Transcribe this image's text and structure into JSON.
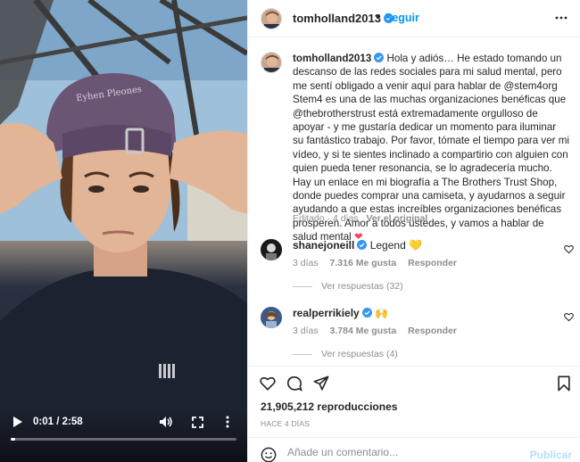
{
  "video": {
    "time": "0:01 / 2:58",
    "progress": 0.006,
    "cap_text": "Eyhen Pleones",
    "icons": {
      "play": "play-icon",
      "volume": "volume-icon",
      "fullscreen": "fullscreen-icon",
      "more": "more-vertical-icon"
    }
  },
  "header": {
    "username": "tomholland2013",
    "separator": "•",
    "follow_label": "Seguir",
    "more_icon": "more-horizontal-icon"
  },
  "caption": {
    "username": "tomholland2013",
    "text": "Hola y adiós… He estado tomando un descanso de las redes sociales para mi salud mental, pero me sentí obligado a venir aquí para hablar de @stem4org Stem4 es una de las muchas organizaciones benéficas que @thebrotherstrust está extremadamente orgulloso de apoyar - y me gustaría dedicar un momento para iluminar su fantástico trabajo. Por favor, tómate el tiempo para ver mi vídeo, y si te sientes inclinado a compartirio con alguien con quien pueda tener resonancia, se lo agradecería mucho. Hay un enlace en mi biografía a The Brothers Trust Shop, donde puedes comprar una camiseta, y ayudarnos a seguir ayudando a que estas increíbles organizaciones benéficas prosperen. Amor a todos ustedes, y vamos a hablar de salud mental",
    "emoji": "❤",
    "edited": "Editado · 4 días",
    "translation_link": "Ver el original"
  },
  "comments": [
    {
      "username": "shanejoneill",
      "text": "Legend",
      "emoji": "💛",
      "time": "3 días",
      "likes": "7.316 Me gusta",
      "reply": "Responder",
      "replies": "Ver respuestas (32)"
    },
    {
      "username": "realperrikiely",
      "text": "",
      "emoji": "🙌",
      "time": "3 días",
      "likes": "3.784 Me gusta",
      "reply": "Responder",
      "replies": "Ver respuestas (4)"
    }
  ],
  "stats": {
    "views": "21,905,212 reproducciones",
    "posted": "HACE 4 DÍAS"
  },
  "comment_box": {
    "placeholder": "Añade un comentario...",
    "publish_label": "Publicar"
  },
  "colors": {
    "accent": "#0095f6",
    "verified": "#3897f0",
    "text": "#262626",
    "muted": "#8e8e8e",
    "publish_disabled": "#b2dffc"
  }
}
